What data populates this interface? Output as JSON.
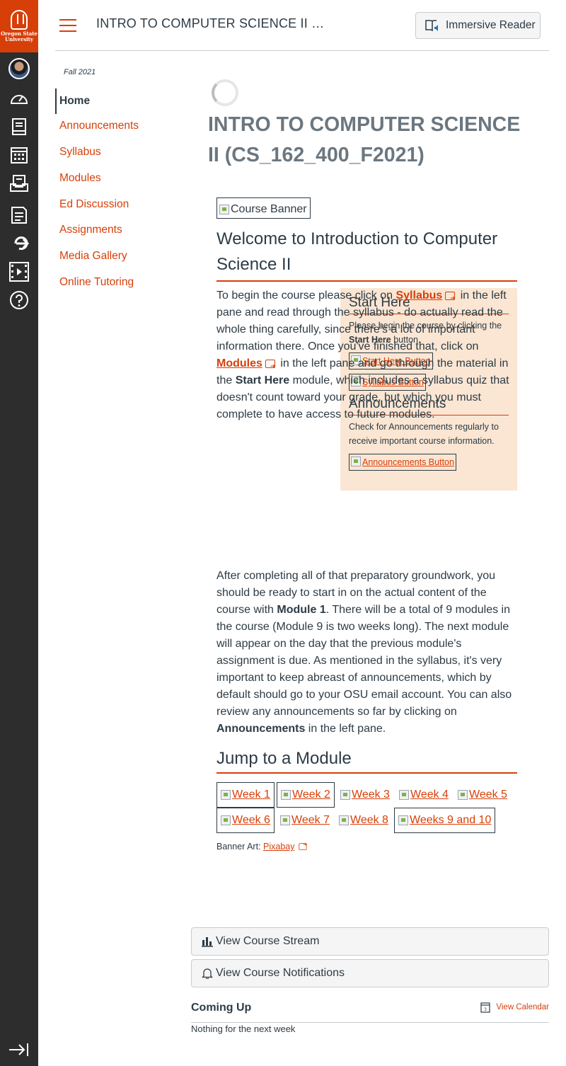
{
  "global_nav": {
    "logo_line1": "Oregon State",
    "logo_line2": "University",
    "icons": [
      "account-avatar",
      "dashboard-icon",
      "courses-icon",
      "calendar-icon",
      "inbox-icon",
      "history-icon",
      "commons-icon",
      "studio-icon",
      "help-icon",
      "collapse-nav-icon"
    ]
  },
  "header": {
    "course_title": "INTRO TO COMPUTER SCIENCE II …",
    "immersive_reader": "Immersive Reader"
  },
  "course_nav": {
    "term": "Fall 2021",
    "items": [
      "Home",
      "Announcements",
      "Syllabus",
      "Modules",
      "Ed Discussion",
      "Assignments",
      "Media Gallery",
      "Online Tutoring"
    ]
  },
  "main": {
    "page_title": "INTRO TO COMPUTER SCIENCE II (CS_162_400_F2021)",
    "banner_alt": "Course Banner",
    "welcome_heading": "Welcome to Introduction to Computer Science II",
    "p1": {
      "a": "To begin the course please click on ",
      "syllabus_link": "Syllabus",
      "b": " in the left pane and read through the syllabus - do actually read the whole thing carefully, since there's a lot of important information there. Once you've finished that, click on ",
      "modules_link": "Modules",
      "c": " in the left pane and go through the material in the ",
      "start_here": "Start Here",
      "d": " module, which includes a syllabus quiz that doesn't count toward your grade, but which you must complete to have access to future modules."
    },
    "p2": {
      "a": "After completing all of that preparatory groundwork, you should be ready to start in on the actual content of the course with ",
      "module1": "Module 1",
      "b": ". There will be a total of 9 modules in the course (Module 9 is two weeks long). The next module will appear on the day that the previous module's assignment is due. As mentioned in the syllabus, it's very important to keep abreast of announcements, which by default should go to your OSU email account. You can also review any announcements so far by clicking on ",
      "announcements": "Announcements",
      "c": " in the left pane."
    },
    "sidebox": {
      "start_heading": "Start Here",
      "start_text_a": "Please begin the course by clicking the ",
      "start_text_bold": "Start Here",
      "start_text_b": " button.",
      "start_button": "Start Here Button",
      "syllabus_button": "Syllabus Button",
      "ann_heading": "Announcements",
      "ann_text": "Check for Announcements regularly to receive important course information.",
      "ann_button": "Announcements Button"
    },
    "jump_heading": "Jump to a Module",
    "weeks": [
      "Week 1",
      "Week 2",
      "Week 3",
      "Week 4",
      "Week 5",
      "Week 6",
      "Week 7",
      "Week 8",
      "Weeks 9 and 10"
    ],
    "credit_label": "Banner Art: ",
    "credit_link": "Pixabay"
  },
  "sidebar": {
    "stream_button": "View Course Stream",
    "notifications_button": "View Course Notifications",
    "coming_up": "Coming Up",
    "view_calendar": "View Calendar",
    "nothing": "Nothing for the next week"
  },
  "colors": {
    "accent": "#d73f09",
    "nav_bg": "#2d2d2d",
    "sidebox_bg": "#fae6d3",
    "text": "#2d3b45"
  }
}
